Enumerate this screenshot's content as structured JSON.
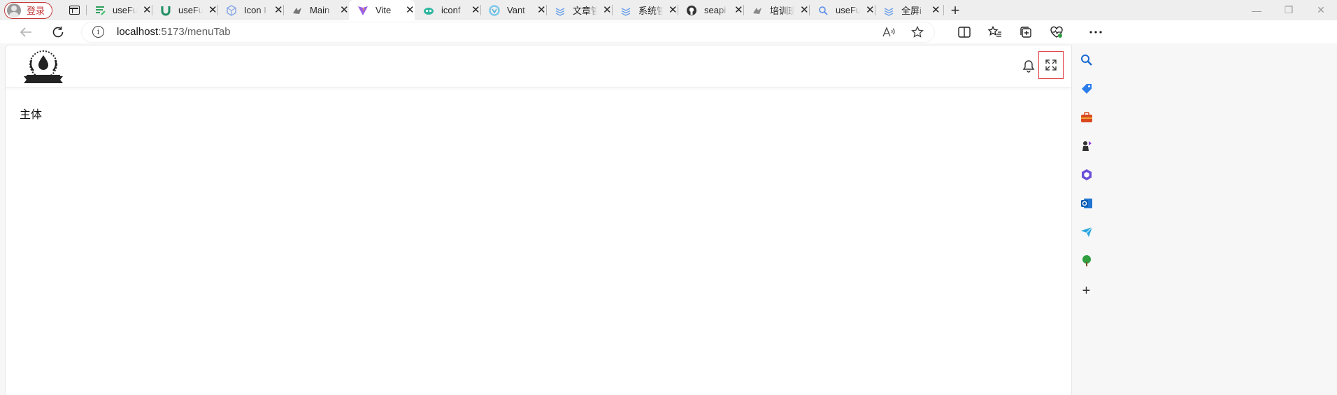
{
  "browser": {
    "profile_label": "登录",
    "tabs": [
      {
        "label": "useFu",
        "icon": "lines-icon",
        "color": "#2f9f5a"
      },
      {
        "label": "useFu",
        "icon": "u-logo-icon",
        "color": "#1f8f63"
      },
      {
        "label": "Icon I",
        "icon": "cube-icon",
        "color": "#8aa8e6"
      },
      {
        "label": "Main",
        "icon": "element-plus-icon",
        "color": "#777777"
      },
      {
        "label": "Vite",
        "icon": "vite-icon",
        "color": "#9b5de5"
      },
      {
        "label": "iconf",
        "icon": "iconfont-icon",
        "color": "#2fb6a0"
      },
      {
        "label": "Vant",
        "icon": "vant-icon",
        "color": "#7fc8e8"
      },
      {
        "label": "文章管",
        "icon": "layers-icon",
        "color": "#6aa0e8"
      },
      {
        "label": "系统管",
        "icon": "layers-icon",
        "color": "#6aa0e8"
      },
      {
        "label": "seapi",
        "icon": "github-icon",
        "color": "#333333"
      },
      {
        "label": "培训班",
        "icon": "element-plus-icon",
        "color": "#888888"
      },
      {
        "label": "useFu",
        "icon": "search-icon",
        "color": "#5b8de8"
      },
      {
        "label": "全屏i",
        "icon": "layers-icon",
        "color": "#6aa0e8"
      }
    ],
    "active_tab_index": 4,
    "url_host": "localhost",
    "url_rest": ":5173/menuTab"
  },
  "page": {
    "body_text": "主体"
  },
  "colors": {
    "accent_red": "#e0393e",
    "profile_red": "#c43a3a"
  }
}
